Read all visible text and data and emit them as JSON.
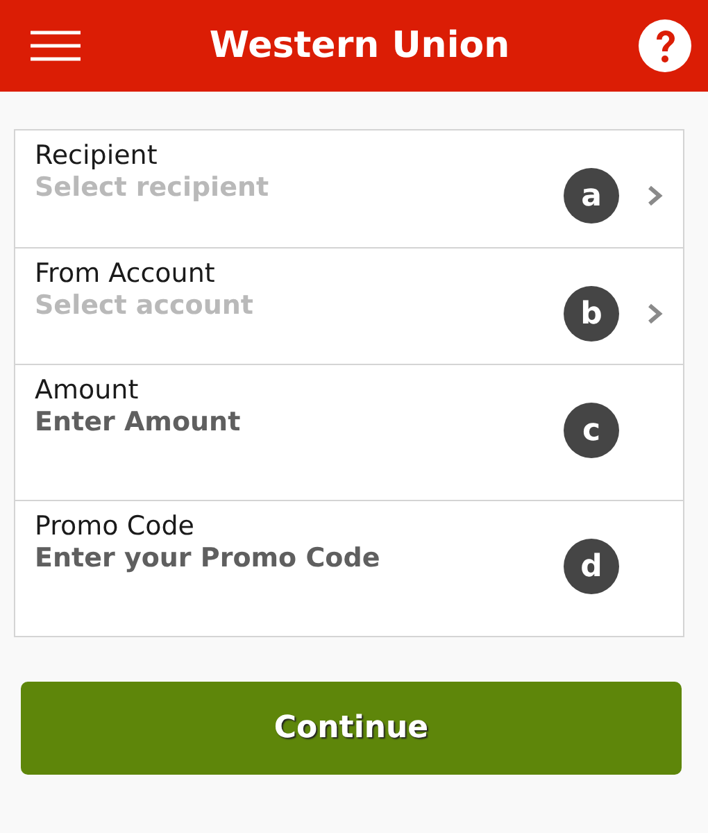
{
  "header": {
    "title": "Western Union"
  },
  "fields": [
    {
      "kind": "select",
      "label": "Recipient",
      "value": "Select recipient",
      "badge": "a"
    },
    {
      "kind": "select",
      "label": "From Account",
      "value": "Select account",
      "badge": "b"
    },
    {
      "kind": "input",
      "label": "Amount",
      "placeholder": "Enter Amount",
      "badge": "c"
    },
    {
      "kind": "input",
      "label": "Promo Code",
      "placeholder": "Enter your Promo Code",
      "badge": "d"
    }
  ],
  "buttons": [
    "Continue"
  ]
}
